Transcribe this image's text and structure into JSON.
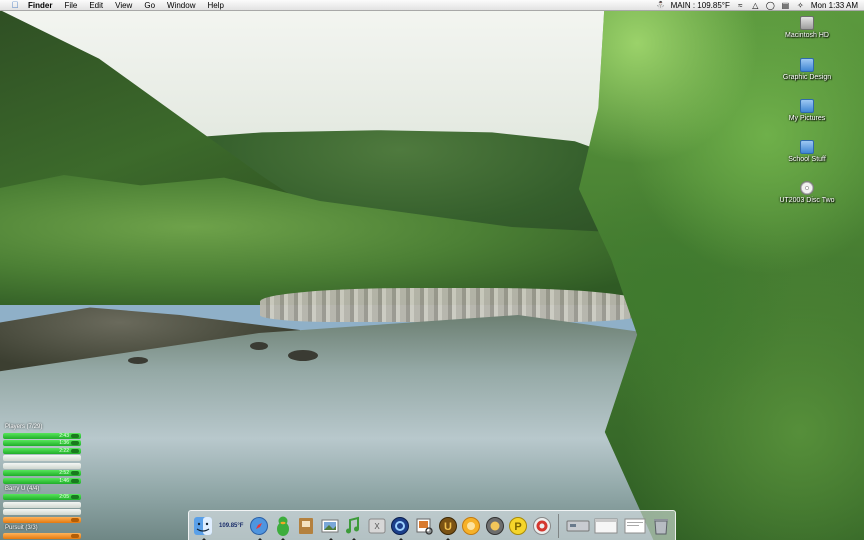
{
  "menubar": {
    "apple_icon": "apple-logo-icon",
    "app_name": "Finder",
    "menus": [
      "File",
      "Edit",
      "View",
      "Go",
      "Window",
      "Help"
    ],
    "status_text": "MAIN : 109.85°F",
    "clock": "Mon 1:33 AM"
  },
  "desktop": {
    "icons": [
      {
        "label": "Macintosh HD",
        "icon": "hard-drive-icon"
      },
      {
        "label": "Graphic Design",
        "icon": "folder-icon"
      },
      {
        "label": "My Pictures",
        "icon": "folder-icon"
      },
      {
        "label": "School Stuff",
        "icon": "folder-icon"
      },
      {
        "label": "UT2003 Disc Two",
        "icon": "cd-disc-icon"
      }
    ]
  },
  "widget": {
    "groups": [
      {
        "title": "Players (7/29)",
        "rows": [
          "2:43",
          "1:36",
          "2:22",
          "",
          "",
          "2:52",
          "1:46"
        ]
      },
      {
        "title": "Barry U (4/4)",
        "rows": [
          "2:05",
          "",
          "",
          ""
        ]
      },
      {
        "title": "Pursuit (3/3)",
        "rows": [
          ""
        ]
      }
    ]
  },
  "dock": {
    "temperature_label": "109.85°F",
    "items": [
      "finder-icon",
      "temperature-monitor-icon",
      "safari-icon",
      "adium-duck-icon",
      "address-book-icon",
      "iphoto-icon",
      "itunes-icon",
      "mac-os-x-icon",
      "quicktime-icon",
      "preview-icon",
      "unreal-tournament-icon",
      "snes-emulator-icon",
      "system-monitor-icon",
      "gold-coin-icon",
      "target-icon"
    ],
    "right_items": [
      "network-icon",
      "window-icon",
      "document-icon",
      "trash-icon"
    ]
  }
}
